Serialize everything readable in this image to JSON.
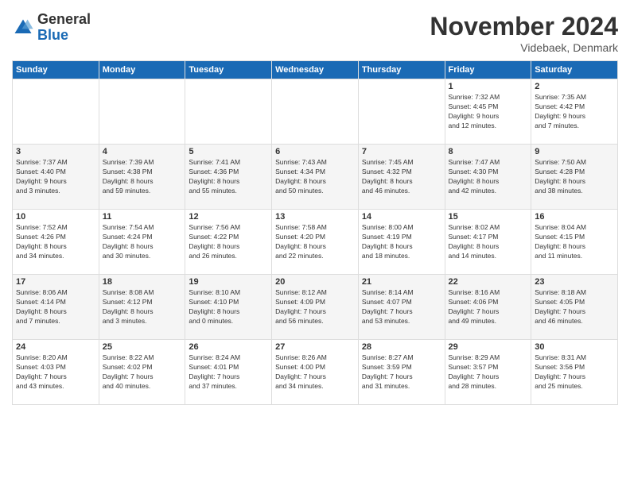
{
  "logo": {
    "general": "General",
    "blue": "Blue"
  },
  "header": {
    "month": "November 2024",
    "location": "Videbaek, Denmark"
  },
  "weekdays": [
    "Sunday",
    "Monday",
    "Tuesday",
    "Wednesday",
    "Thursday",
    "Friday",
    "Saturday"
  ],
  "weeks": [
    [
      {
        "day": "",
        "info": ""
      },
      {
        "day": "",
        "info": ""
      },
      {
        "day": "",
        "info": ""
      },
      {
        "day": "",
        "info": ""
      },
      {
        "day": "",
        "info": ""
      },
      {
        "day": "1",
        "info": "Sunrise: 7:32 AM\nSunset: 4:45 PM\nDaylight: 9 hours\nand 12 minutes."
      },
      {
        "day": "2",
        "info": "Sunrise: 7:35 AM\nSunset: 4:42 PM\nDaylight: 9 hours\nand 7 minutes."
      }
    ],
    [
      {
        "day": "3",
        "info": "Sunrise: 7:37 AM\nSunset: 4:40 PM\nDaylight: 9 hours\nand 3 minutes."
      },
      {
        "day": "4",
        "info": "Sunrise: 7:39 AM\nSunset: 4:38 PM\nDaylight: 8 hours\nand 59 minutes."
      },
      {
        "day": "5",
        "info": "Sunrise: 7:41 AM\nSunset: 4:36 PM\nDaylight: 8 hours\nand 55 minutes."
      },
      {
        "day": "6",
        "info": "Sunrise: 7:43 AM\nSunset: 4:34 PM\nDaylight: 8 hours\nand 50 minutes."
      },
      {
        "day": "7",
        "info": "Sunrise: 7:45 AM\nSunset: 4:32 PM\nDaylight: 8 hours\nand 46 minutes."
      },
      {
        "day": "8",
        "info": "Sunrise: 7:47 AM\nSunset: 4:30 PM\nDaylight: 8 hours\nand 42 minutes."
      },
      {
        "day": "9",
        "info": "Sunrise: 7:50 AM\nSunset: 4:28 PM\nDaylight: 8 hours\nand 38 minutes."
      }
    ],
    [
      {
        "day": "10",
        "info": "Sunrise: 7:52 AM\nSunset: 4:26 PM\nDaylight: 8 hours\nand 34 minutes."
      },
      {
        "day": "11",
        "info": "Sunrise: 7:54 AM\nSunset: 4:24 PM\nDaylight: 8 hours\nand 30 minutes."
      },
      {
        "day": "12",
        "info": "Sunrise: 7:56 AM\nSunset: 4:22 PM\nDaylight: 8 hours\nand 26 minutes."
      },
      {
        "day": "13",
        "info": "Sunrise: 7:58 AM\nSunset: 4:20 PM\nDaylight: 8 hours\nand 22 minutes."
      },
      {
        "day": "14",
        "info": "Sunrise: 8:00 AM\nSunset: 4:19 PM\nDaylight: 8 hours\nand 18 minutes."
      },
      {
        "day": "15",
        "info": "Sunrise: 8:02 AM\nSunset: 4:17 PM\nDaylight: 8 hours\nand 14 minutes."
      },
      {
        "day": "16",
        "info": "Sunrise: 8:04 AM\nSunset: 4:15 PM\nDaylight: 8 hours\nand 11 minutes."
      }
    ],
    [
      {
        "day": "17",
        "info": "Sunrise: 8:06 AM\nSunset: 4:14 PM\nDaylight: 8 hours\nand 7 minutes."
      },
      {
        "day": "18",
        "info": "Sunrise: 8:08 AM\nSunset: 4:12 PM\nDaylight: 8 hours\nand 3 minutes."
      },
      {
        "day": "19",
        "info": "Sunrise: 8:10 AM\nSunset: 4:10 PM\nDaylight: 8 hours\nand 0 minutes."
      },
      {
        "day": "20",
        "info": "Sunrise: 8:12 AM\nSunset: 4:09 PM\nDaylight: 7 hours\nand 56 minutes."
      },
      {
        "day": "21",
        "info": "Sunrise: 8:14 AM\nSunset: 4:07 PM\nDaylight: 7 hours\nand 53 minutes."
      },
      {
        "day": "22",
        "info": "Sunrise: 8:16 AM\nSunset: 4:06 PM\nDaylight: 7 hours\nand 49 minutes."
      },
      {
        "day": "23",
        "info": "Sunrise: 8:18 AM\nSunset: 4:05 PM\nDaylight: 7 hours\nand 46 minutes."
      }
    ],
    [
      {
        "day": "24",
        "info": "Sunrise: 8:20 AM\nSunset: 4:03 PM\nDaylight: 7 hours\nand 43 minutes."
      },
      {
        "day": "25",
        "info": "Sunrise: 8:22 AM\nSunset: 4:02 PM\nDaylight: 7 hours\nand 40 minutes."
      },
      {
        "day": "26",
        "info": "Sunrise: 8:24 AM\nSunset: 4:01 PM\nDaylight: 7 hours\nand 37 minutes."
      },
      {
        "day": "27",
        "info": "Sunrise: 8:26 AM\nSunset: 4:00 PM\nDaylight: 7 hours\nand 34 minutes."
      },
      {
        "day": "28",
        "info": "Sunrise: 8:27 AM\nSunset: 3:59 PM\nDaylight: 7 hours\nand 31 minutes."
      },
      {
        "day": "29",
        "info": "Sunrise: 8:29 AM\nSunset: 3:57 PM\nDaylight: 7 hours\nand 28 minutes."
      },
      {
        "day": "30",
        "info": "Sunrise: 8:31 AM\nSunset: 3:56 PM\nDaylight: 7 hours\nand 25 minutes."
      }
    ]
  ]
}
